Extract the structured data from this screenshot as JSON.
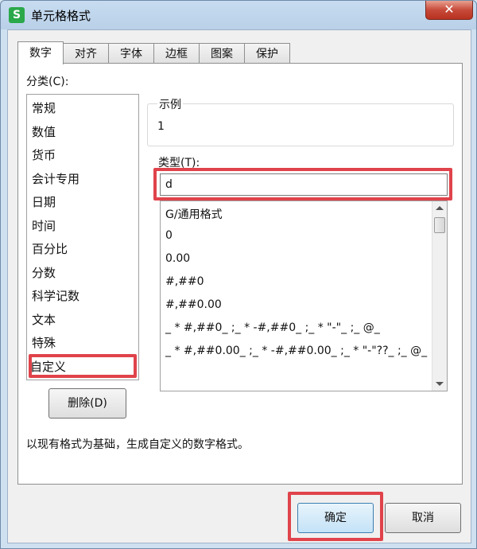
{
  "window": {
    "title": "单元格格式",
    "app_icon": "S",
    "close_glyph": "✕"
  },
  "tabs": [
    {
      "label": "数字",
      "active": true
    },
    {
      "label": "对齐"
    },
    {
      "label": "字体"
    },
    {
      "label": "边框"
    },
    {
      "label": "图案"
    },
    {
      "label": "保护"
    }
  ],
  "category": {
    "label": "分类(C):",
    "items": [
      "常规",
      "数值",
      "货币",
      "会计专用",
      "日期",
      "时间",
      "百分比",
      "分数",
      "科学记数",
      "文本",
      "特殊",
      "自定义"
    ],
    "selected": "自定义"
  },
  "sample": {
    "legend": "示例",
    "value": "1"
  },
  "type": {
    "label": "类型(T):",
    "value": "d",
    "formats": [
      "G/通用格式",
      "0",
      "0.00",
      "#,##0",
      "#,##0.00",
      "_ * #,##0_ ;_ * -#,##0_ ;_ * \"-\"_ ;_ @_",
      "_ * #,##0.00_ ;_ * -#,##0.00_ ;_ * \"-\"??_ ;_ @_"
    ]
  },
  "delete_button": "删除(D)",
  "description": "以现有格式为基础，生成自定义的数字格式。",
  "buttons": {
    "ok": "确定",
    "cancel": "取消"
  },
  "colors": {
    "highlight": "#e0434b",
    "accent": "#3c7fb1"
  }
}
